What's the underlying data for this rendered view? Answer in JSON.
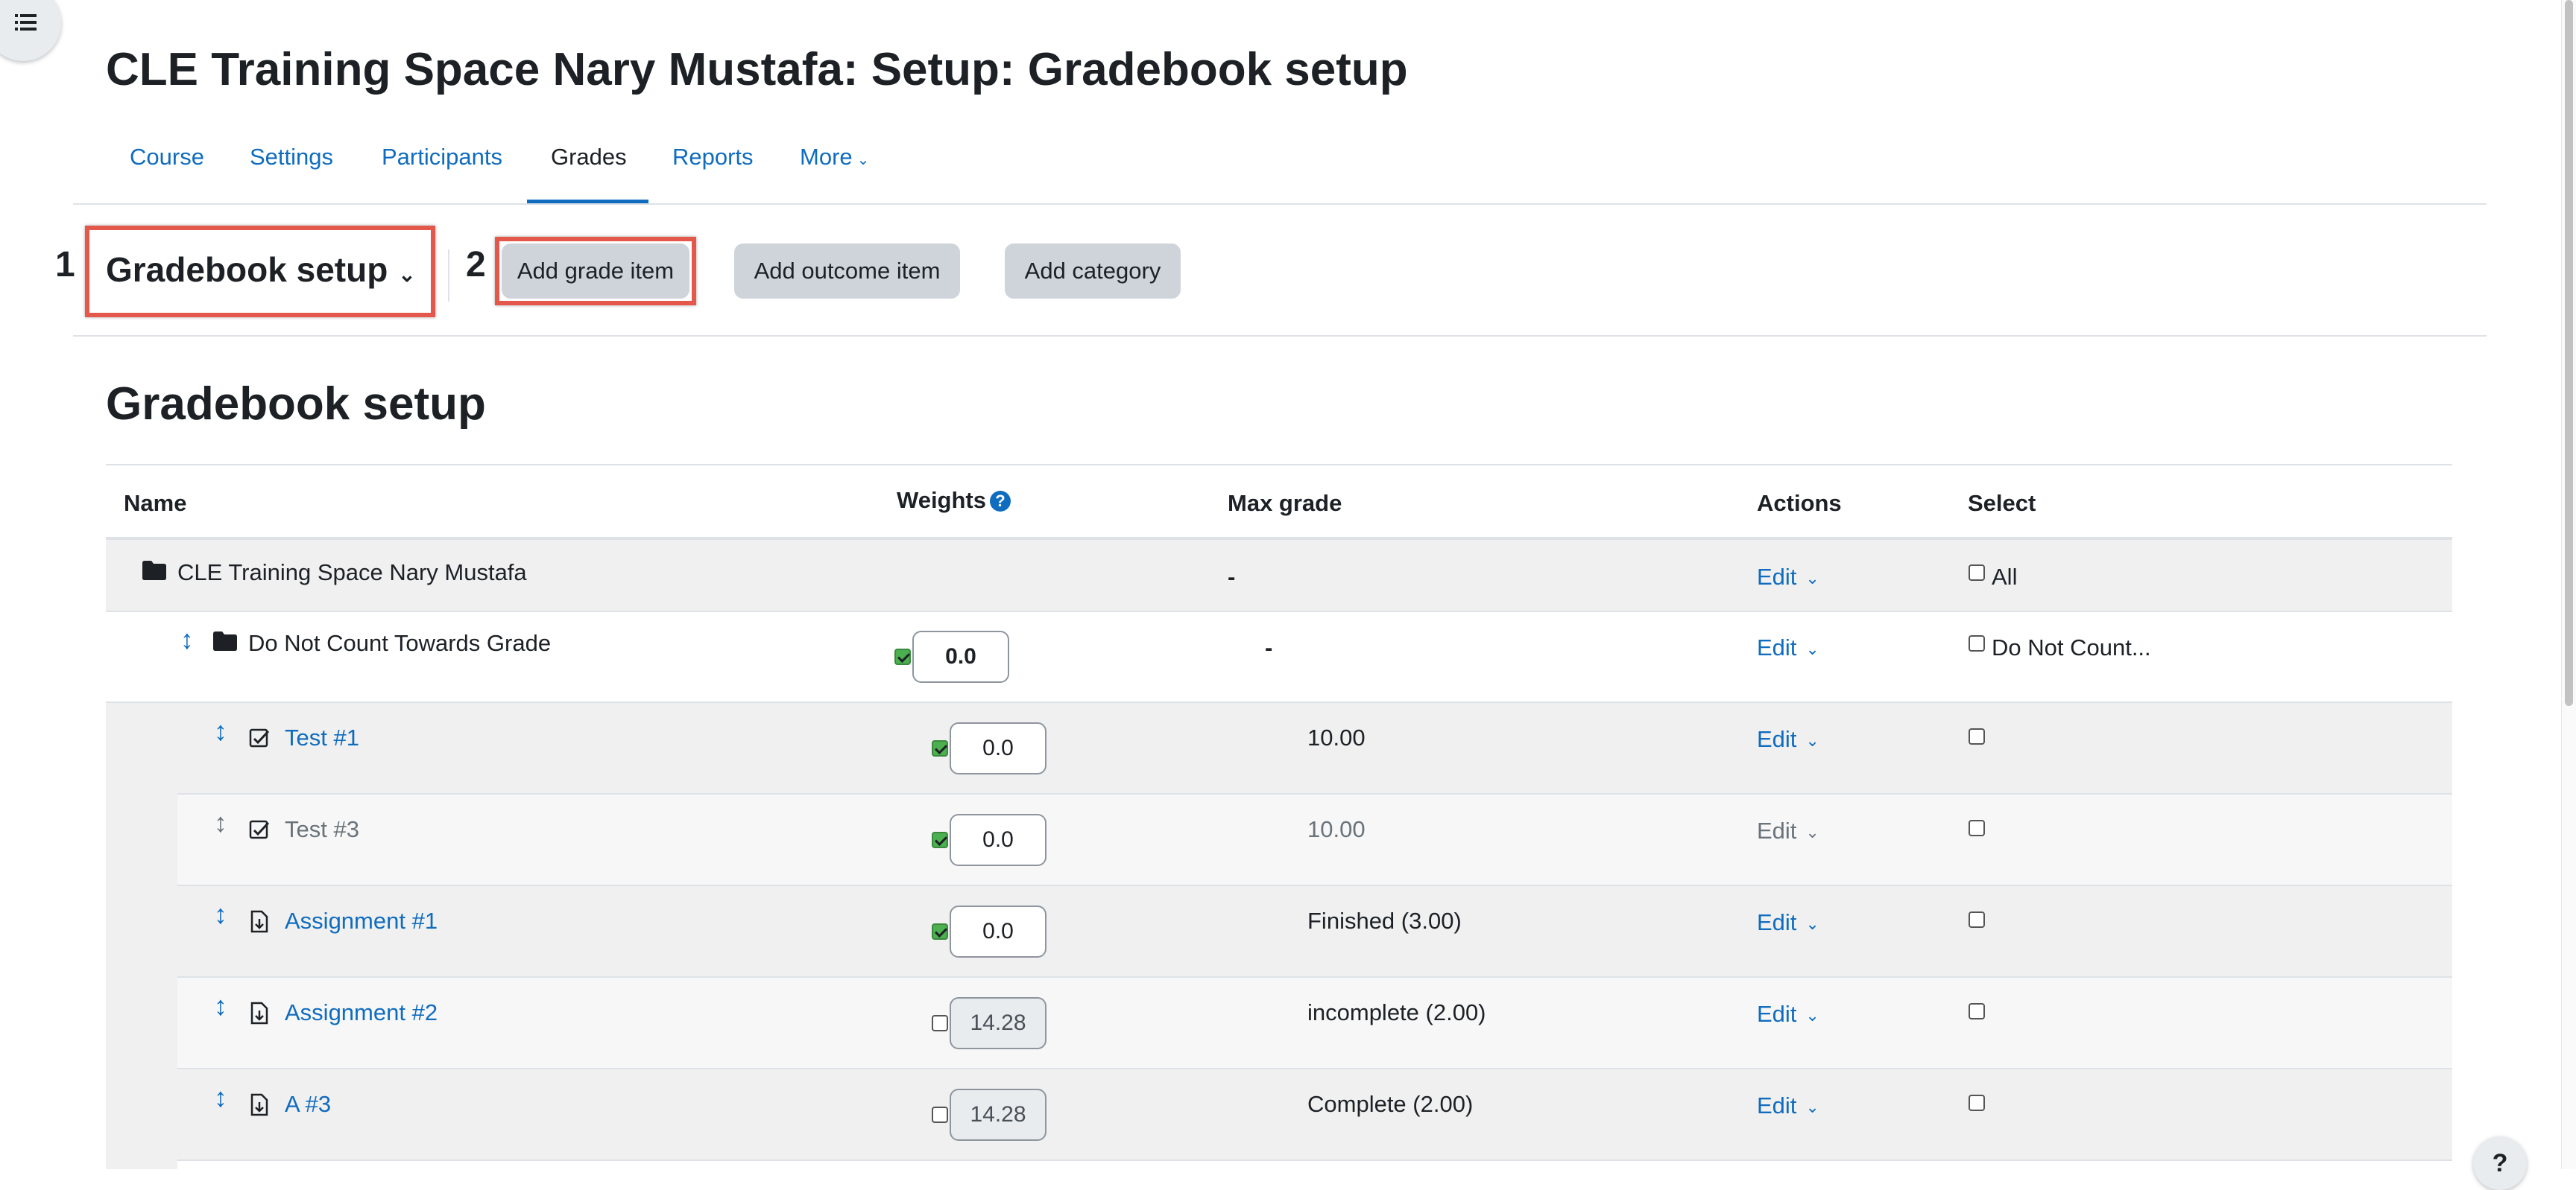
{
  "page": {
    "title": "CLE Training Space Nary Mustafa: Setup: Gradebook setup"
  },
  "nav": {
    "tabs": [
      {
        "label": "Course"
      },
      {
        "label": "Settings"
      },
      {
        "label": "Participants"
      },
      {
        "label": "Grades"
      },
      {
        "label": "Reports"
      },
      {
        "label": "More"
      }
    ],
    "active": "Grades"
  },
  "toolbar": {
    "step1": "1",
    "step2": "2",
    "gradebook_select": "Gradebook setup",
    "add_grade_item": "Add grade item",
    "add_outcome_item": "Add outcome item",
    "add_category": "Add category"
  },
  "section": {
    "title": "Gradebook setup"
  },
  "table": {
    "headers": {
      "name": "Name",
      "weights": "Weights",
      "max_grade": "Max grade",
      "actions": "Actions",
      "select": "Select"
    },
    "edit_label": "Edit",
    "course_row": {
      "name": "CLE Training Space Nary Mustafa",
      "max": "-",
      "select_label": "All"
    },
    "category_row": {
      "name": "Do Not Count Towards Grade",
      "weight": "0.0",
      "weight_checked": true,
      "max": "-",
      "select_label": "Do Not Count..."
    },
    "items": [
      {
        "name": "Test #1",
        "icon": "quiz-icon",
        "weight": "0.0",
        "weight_checked": true,
        "max": "10.00",
        "hidden": false
      },
      {
        "name": "Test #3",
        "icon": "quiz-icon",
        "weight": "0.0",
        "weight_checked": true,
        "max": "10.00",
        "hidden": true
      },
      {
        "name": "Assignment #1",
        "icon": "assignment-icon",
        "weight": "0.0",
        "weight_checked": true,
        "max": "Finished (3.00)",
        "hidden": false
      },
      {
        "name": "Assignment #2",
        "icon": "assignment-icon",
        "weight": "14.28",
        "weight_checked": false,
        "max": "incomplete (2.00)",
        "hidden": false
      },
      {
        "name": "A #3",
        "icon": "assignment-icon",
        "weight": "14.28",
        "weight_checked": false,
        "max": "Complete (2.00)",
        "hidden": false
      }
    ]
  },
  "help": {
    "label": "?"
  },
  "colors": {
    "link": "#0f6cbf",
    "highlight": "#e4584c",
    "checked": "#4caf50"
  }
}
